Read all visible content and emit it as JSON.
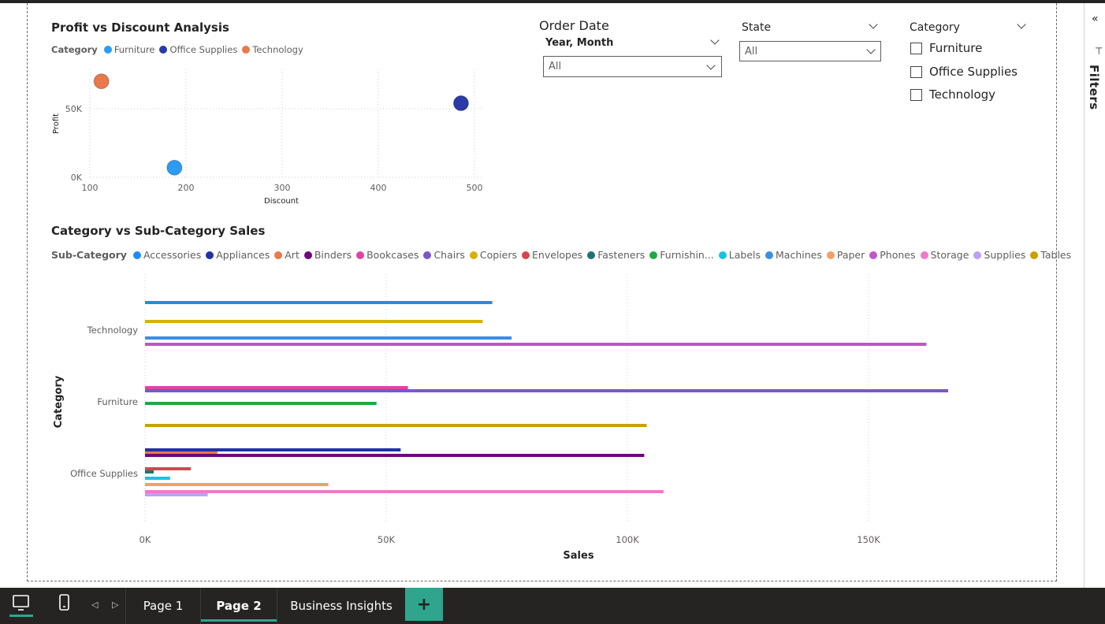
{
  "scatter": {
    "title": "Profit vs Discount Analysis",
    "legend_title": "Category",
    "xlabel": "Discount",
    "ylabel": "Profit",
    "x_ticks": [
      "100",
      "200",
      "300",
      "400",
      "500"
    ],
    "y_ticks": [
      "0K",
      "50K"
    ]
  },
  "bar": {
    "title": "Category vs Sub-Category Sales",
    "legend_title": "Sub-Category",
    "xlabel": "Sales",
    "ylabel": "Category",
    "x_ticks": [
      "0K",
      "50K",
      "100K",
      "150K"
    ]
  },
  "slicers": {
    "order_date": {
      "title": "Order Date",
      "subtitle": "Year, Month",
      "value": "All"
    },
    "state": {
      "title": "State",
      "value": "All"
    },
    "category": {
      "title": "Category",
      "options": [
        "Furniture",
        "Office Supplies",
        "Technology"
      ]
    }
  },
  "filters_pane": {
    "label": "Filters"
  },
  "pages": {
    "tabs": [
      "Page 1",
      "Page 2",
      "Business Insights"
    ],
    "active": "Page 2",
    "add_label": "+"
  },
  "colors": {
    "accent": "#2fa58e",
    "Furniture": "#2b9bf4",
    "Office Supplies": "#2a3aa6",
    "Technology": "#e9784b"
  },
  "chart_data": [
    {
      "type": "scatter",
      "title": "Profit vs Discount Analysis",
      "xlabel": "Discount",
      "ylabel": "Profit",
      "xlim": [
        100,
        500
      ],
      "ylim": [
        0,
        70000
      ],
      "legend_placement": "top-left",
      "series": [
        {
          "name": "Furniture",
          "color": "#2b9bf4",
          "x": 188,
          "y": 7000
        },
        {
          "name": "Office Supplies",
          "color": "#2a3aa6",
          "x": 486,
          "y": 54000
        },
        {
          "name": "Technology",
          "color": "#e9784b",
          "x": 112,
          "y": 70000
        }
      ]
    },
    {
      "type": "bar",
      "orientation": "horizontal",
      "title": "Category vs Sub-Category Sales",
      "xlabel": "Sales",
      "ylabel": "Category",
      "xlim": [
        0,
        170000
      ],
      "legend_placement": "top-left",
      "categories": [
        "Technology",
        "Furniture",
        "Office Supplies"
      ],
      "legend": [
        {
          "name": "Accessories",
          "color": "#1f8cf0"
        },
        {
          "name": "Appliances",
          "color": "#2232a3"
        },
        {
          "name": "Art",
          "color": "#e9784b"
        },
        {
          "name": "Binders",
          "color": "#6b0a7a"
        },
        {
          "name": "Bookcases",
          "color": "#e0449e"
        },
        {
          "name": "Chairs",
          "color": "#7b57c8"
        },
        {
          "name": "Copiers",
          "color": "#d6b100"
        },
        {
          "name": "Envelopes",
          "color": "#d6464f"
        },
        {
          "name": "Fasteners",
          "color": "#1e7472"
        },
        {
          "name": "Furnishin...",
          "color": "#21a845"
        },
        {
          "name": "Labels",
          "color": "#19c2e0"
        },
        {
          "name": "Machines",
          "color": "#3c8ee0"
        },
        {
          "name": "Paper",
          "color": "#f4a066"
        },
        {
          "name": "Phones",
          "color": "#bf55c8"
        },
        {
          "name": "Storage",
          "color": "#ee7ac8"
        },
        {
          "name": "Supplies",
          "color": "#bba2f2"
        },
        {
          "name": "Tables",
          "color": "#c9a000"
        }
      ],
      "series": [
        {
          "name": "Accessories",
          "category": "Technology",
          "value": 72000
        },
        {
          "name": "Copiers",
          "category": "Technology",
          "value": 70000
        },
        {
          "name": "Machines",
          "category": "Technology",
          "value": 76000
        },
        {
          "name": "Phones",
          "category": "Technology",
          "value": 162000
        },
        {
          "name": "Bookcases",
          "category": "Furniture",
          "value": 54500
        },
        {
          "name": "Chairs",
          "category": "Furniture",
          "value": 166500
        },
        {
          "name": "Furnishin...",
          "category": "Furniture",
          "value": 48000
        },
        {
          "name": "Tables",
          "category": "Furniture",
          "value": 104000
        },
        {
          "name": "Appliances",
          "category": "Office Supplies",
          "value": 53000
        },
        {
          "name": "Art",
          "category": "Office Supplies",
          "value": 15000
        },
        {
          "name": "Binders",
          "category": "Office Supplies",
          "value": 103500
        },
        {
          "name": "Envelopes",
          "category": "Office Supplies",
          "value": 9500
        },
        {
          "name": "Fasteners",
          "category": "Office Supplies",
          "value": 1800
        },
        {
          "name": "Labels",
          "category": "Office Supplies",
          "value": 5200
        },
        {
          "name": "Paper",
          "category": "Office Supplies",
          "value": 38000
        },
        {
          "name": "Storage",
          "category": "Office Supplies",
          "value": 107500
        },
        {
          "name": "Supplies",
          "category": "Office Supplies",
          "value": 13000
        }
      ]
    }
  ]
}
